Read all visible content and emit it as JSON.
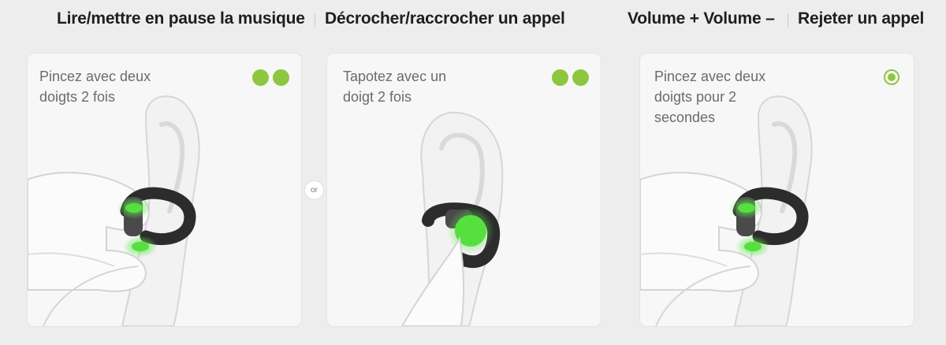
{
  "header": {
    "play_pause": "Lire/mettre en pause la musique",
    "answer_call": "Décrocher/raccrocher un appel",
    "volume": "Volume + Volume –",
    "reject_call": "Rejeter un appel"
  },
  "cards": [
    {
      "instruction": "Pincez avec deux\ndoigts 2 fois",
      "indicator": "two-dots"
    },
    {
      "instruction": "Tapotez avec un\ndoigt 2 fois",
      "indicator": "two-dots"
    },
    {
      "instruction": "Pincez avec deux\ndoigts pour 2\nsecondes",
      "indicator": "press-hold-ring"
    }
  ],
  "or_label": "or",
  "colors": {
    "accent": "#8dc63f",
    "glow": "#58e04a",
    "card_bg": "#f7f7f7",
    "page_bg": "#ededed"
  }
}
